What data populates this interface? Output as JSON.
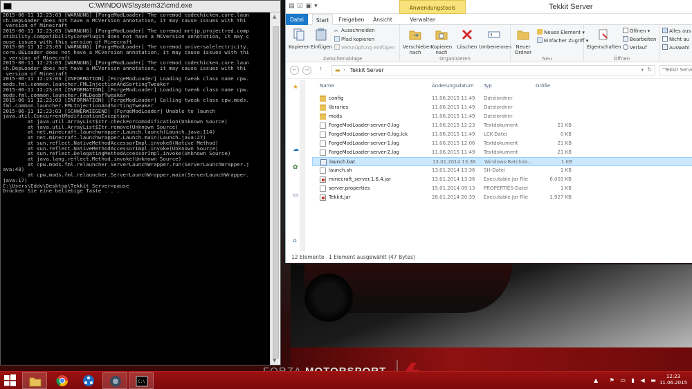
{
  "cmd": {
    "title": "C:\\WINDOWS\\system32\\cmd.exe",
    "lines": [
      "2015-06-11 12:23:03 [WARNUNG] [ForgeModLoader] The coremod codechicken.core.laun",
      "ch.DepLoader does not have a MCVersion annotation, it may cause issues with thi",
      " version of Minecraft",
      "2015-06-11 12:23:03 [WARNUNG] [ForgeModLoader] The coremod mrtjp.projectred.comp",
      "atibility.CompatibilityCorePlugin does not have a MCVersion annotation, it may c",
      "ause issues with this version of Minecraft",
      "2015-06-11 12:23:03 [WARNUNG] [ForgeModLoader] The coremod universalelectricity.",
      "core.UELoader does not have a MCVersion annotation, it may cause issues with thi",
      "s version of Minecraft",
      "2015-06-11 12:23:03 [WARNUNG] [ForgeModLoader] The coremod codechicken.core.laun",
      "ch.DepLoader does not have a MCVersion annotation, it may cause issues with thi",
      " version of Minecraft",
      "2015-06-11 12:23:03 [INFORMATION] [ForgeModLoader] Loading tweak class name cpw.",
      "mods.fml.common.launcher.FMLInjectionAndSortingTweaker",
      "2015-06-11 12:23:03 [INFORMATION] [ForgeModLoader] Loading tweak class name cpw.",
      "mods.fml.common.launcher.FMLDeobfTweaker",
      "2015-06-11 12:23:03 [INFORMATION] [ForgeModLoader] Calling tweak class cpw.mods.",
      "fml.common.launcher.FMLInjectionAndSortingTweaker",
      "2015-06-11 12:23:03 [SCHWERWIEGEND] [ForgeModLoader] Unable to launch",
      "java.util.ConcurrentModificationException",
      "        at java.util.ArrayList$Itr.checkForComodification(Unknown Source)",
      "        at java.util.ArrayList$Itr.remove(Unknown Source)",
      "        at net.minecraft.launchwrapper.Launch.launch(Launch.java:114)",
      "        at net.minecraft.launchwrapper.Launch.main(Launch.java:27)",
      "        at sun.reflect.NativeMethodAccessorImpl.invoke0(Native Method)",
      "        at sun.reflect.NativeMethodAccessorImpl.invoke(Unknown Source)",
      "        at sun.reflect.DelegatingMethodAccessorImpl.invoke(Unknown Source)",
      "        at java.lang.reflect.Method.invoke(Unknown Source)",
      "        at cpw.mods.fml.relauncher.ServerLaunchWrapper.run(ServerLaunchWrapper.j",
      "ava:48)",
      "        at cpw.mods.fml.relauncher.ServerLaunchWrapper.main(ServerLaunchWrapper.",
      "java:17)",
      "",
      "C:\\Users\\Eddy\\Desktop\\Tekkit Server>pause",
      "Drücken Sie eine beliebige Taste . . ."
    ]
  },
  "explorer": {
    "title": "Tekkit Server",
    "context_tab": "Anwendungstools",
    "tabs": [
      "Datei",
      "Start",
      "Freigeben",
      "Ansicht",
      "Verwalten"
    ],
    "ribbon": {
      "clipboard": {
        "label": "Zwischenablage",
        "copy": "Kopieren",
        "paste": "Einfügen",
        "cut": "Ausschneiden",
        "copy_path": "Pfad kopieren",
        "paste_shortcut": "Verknüpfung einfügen"
      },
      "organize": {
        "label": "Organisieren",
        "move_to": "Verschieben nach",
        "copy_to": "Kopieren nach",
        "delete": "Löschen",
        "rename": "Umbenennen"
      },
      "new": {
        "label": "Neu",
        "new_folder": "Neuer Ordner",
        "new_item": "Neues Element",
        "easy_access": "Einfacher Zugriff"
      },
      "open": {
        "label": "Öffnen",
        "properties": "Eigenschaften",
        "open": "Öffnen",
        "edit": "Bearbeiten",
        "history": "Verlauf"
      },
      "select": {
        "select_all": "Alles aus",
        "select_none": "Nicht au",
        "invert": "Auswahl"
      }
    },
    "address": "Tekkit Server",
    "search_placeholder": "\"Tekkit Server",
    "columns": {
      "name": "Name",
      "date": "Änderungsdatum",
      "type": "Typ",
      "size": "Größe"
    },
    "files": [
      {
        "name": "config",
        "date": "11.06.2015 11:49",
        "type": "Dateiordner",
        "size": "",
        "kind": "folder"
      },
      {
        "name": "libraries",
        "date": "11.06.2015 11:49",
        "type": "Dateiordner",
        "size": "",
        "kind": "folder"
      },
      {
        "name": "mods",
        "date": "11.06.2015 11:49",
        "type": "Dateiordner",
        "size": "",
        "kind": "folder"
      },
      {
        "name": "ForgeModLoader-server-0.log",
        "date": "11.06.2015 12:23",
        "type": "Textdokument",
        "size": "21 KB",
        "kind": "doc"
      },
      {
        "name": "ForgeModLoader-server-0.log.lck",
        "date": "11.06.2015 11:49",
        "type": "LCK-Datei",
        "size": "0 KB",
        "kind": "doc"
      },
      {
        "name": "ForgeModLoader-server-1.log",
        "date": "11.06.2015 12:06",
        "type": "Textdokument",
        "size": "21 KB",
        "kind": "doc"
      },
      {
        "name": "ForgeModLoader-server-2.log",
        "date": "11.06.2015 11:49",
        "type": "Textdokument",
        "size": "21 KB",
        "kind": "doc"
      },
      {
        "name": "launch.bat",
        "date": "13.01.2014 13:36",
        "type": "Windows-Batchda...",
        "size": "1 KB",
        "kind": "bat",
        "selected": true
      },
      {
        "name": "launch.sh",
        "date": "13.01.2014 13:36",
        "type": "SH-Datei",
        "size": "1 KB",
        "kind": "doc"
      },
      {
        "name": "minecraft_server.1.6.4.jar",
        "date": "13.01.2014 13:36",
        "type": "Executable Jar File",
        "size": "6.003 KB",
        "kind": "jar"
      },
      {
        "name": "server.properties",
        "date": "15.01.2014 09:13",
        "type": "PROPERTIES-Datei",
        "size": "1 KB",
        "kind": "doc"
      },
      {
        "name": "Tekkit.jar",
        "date": "28.01.2014 20:39",
        "type": "Executable Jar File",
        "size": "1.927 KB",
        "kind": "jar"
      }
    ],
    "status": {
      "count": "12 Elemente",
      "selection": "1 Element ausgewählt (47 Bytes)"
    }
  },
  "wallpaper": {
    "brand_a": "FORZA",
    "brand_b": "MOTORSPORT",
    "brand_num": "4"
  },
  "taskbar": {
    "time": "12:23",
    "date": "11.06.2015"
  },
  "colors": {
    "taskbar": "#8e0e0e",
    "ribbon_file_tab": "#1979ca",
    "context_tab": "#f7e27b",
    "selection": "#cce8ff"
  }
}
